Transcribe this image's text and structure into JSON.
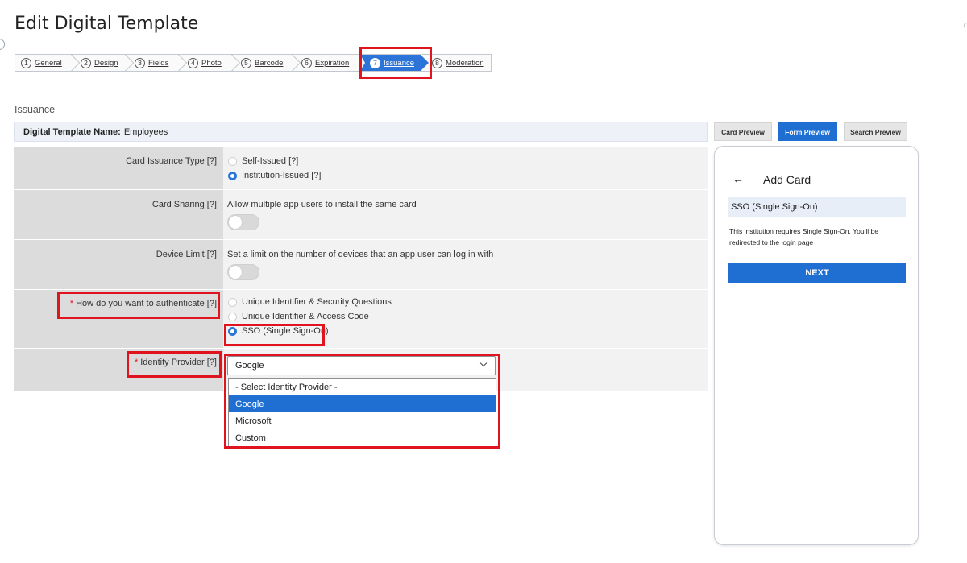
{
  "page": {
    "title": "Edit Digital Template",
    "section": "Issuance"
  },
  "wizard": {
    "steps": [
      {
        "num": "1",
        "label": "General"
      },
      {
        "num": "2",
        "label": "Design"
      },
      {
        "num": "3",
        "label": "Fields"
      },
      {
        "num": "4",
        "label": "Photo"
      },
      {
        "num": "5",
        "label": "Barcode"
      },
      {
        "num": "6",
        "label": "Expiration"
      },
      {
        "num": "7",
        "label": "Issuance",
        "active": true
      },
      {
        "num": "8",
        "label": "Moderation"
      }
    ]
  },
  "template": {
    "name_label": "Digital Template Name:",
    "name_value": "Employees"
  },
  "form": {
    "card_issuance": {
      "label": "Card Issuance Type [?]",
      "options": [
        "Self-Issued [?]",
        "Institution-Issued [?]"
      ],
      "selected": "Institution-Issued [?]"
    },
    "card_sharing": {
      "label": "Card Sharing [?]",
      "description": "Allow multiple app users to install the same card",
      "enabled": false
    },
    "device_limit": {
      "label": "Device Limit [?]",
      "description": "Set a limit on the number of devices that an app user can log in with",
      "enabled": false
    },
    "authenticate": {
      "required_mark": "*",
      "label": "How do you want to authenticate [?]",
      "options": [
        "Unique Identifier & Security Questions",
        "Unique Identifier & Access Code",
        "SSO (Single Sign-On)"
      ],
      "selected": "SSO (Single Sign-On)"
    },
    "identity_provider": {
      "required_mark": "*",
      "label": "Identity Provider [?]",
      "value": "Google",
      "options": [
        "- Select Identity Provider -",
        "Google",
        "Microsoft",
        "Custom"
      ],
      "highlighted": "Google"
    }
  },
  "preview": {
    "tabs": [
      "Card Preview",
      "Form Preview",
      "Search Preview"
    ],
    "active_tab": "Form Preview",
    "back_icon": "←",
    "title": "Add Card",
    "band": "SSO (Single Sign-On)",
    "description": "This institution requires Single Sign-On. You'll be redirected to the login page",
    "button": "NEXT"
  },
  "colors": {
    "accent": "#2d74d8",
    "highlight": "#e0141e",
    "required": "#e0141e"
  }
}
